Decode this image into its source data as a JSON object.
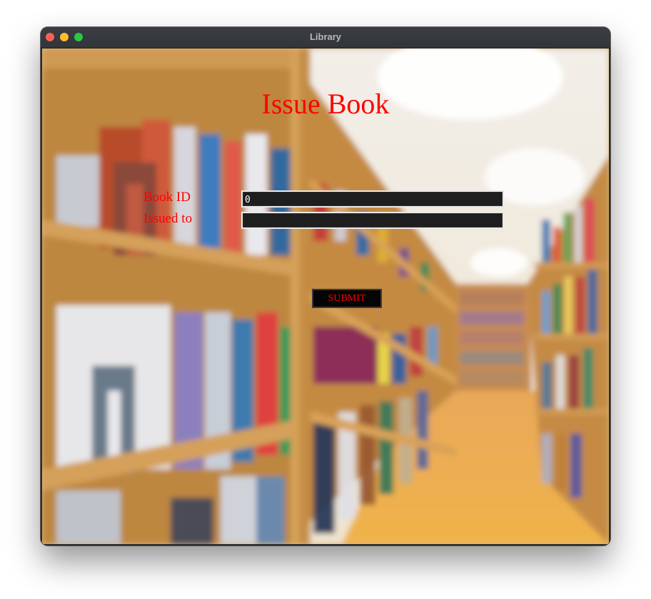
{
  "window": {
    "title": "Library"
  },
  "app": {
    "heading": "Issue Book",
    "accent_color": "#ff0000"
  },
  "form": {
    "book_id_label": "Book ID",
    "book_id_value": "0",
    "issued_to_label": "Issued to",
    "issued_to_value": "",
    "submit_label": "SUBMIT"
  },
  "background": {
    "description_icon": "blurred-library-bookshelves-image"
  }
}
